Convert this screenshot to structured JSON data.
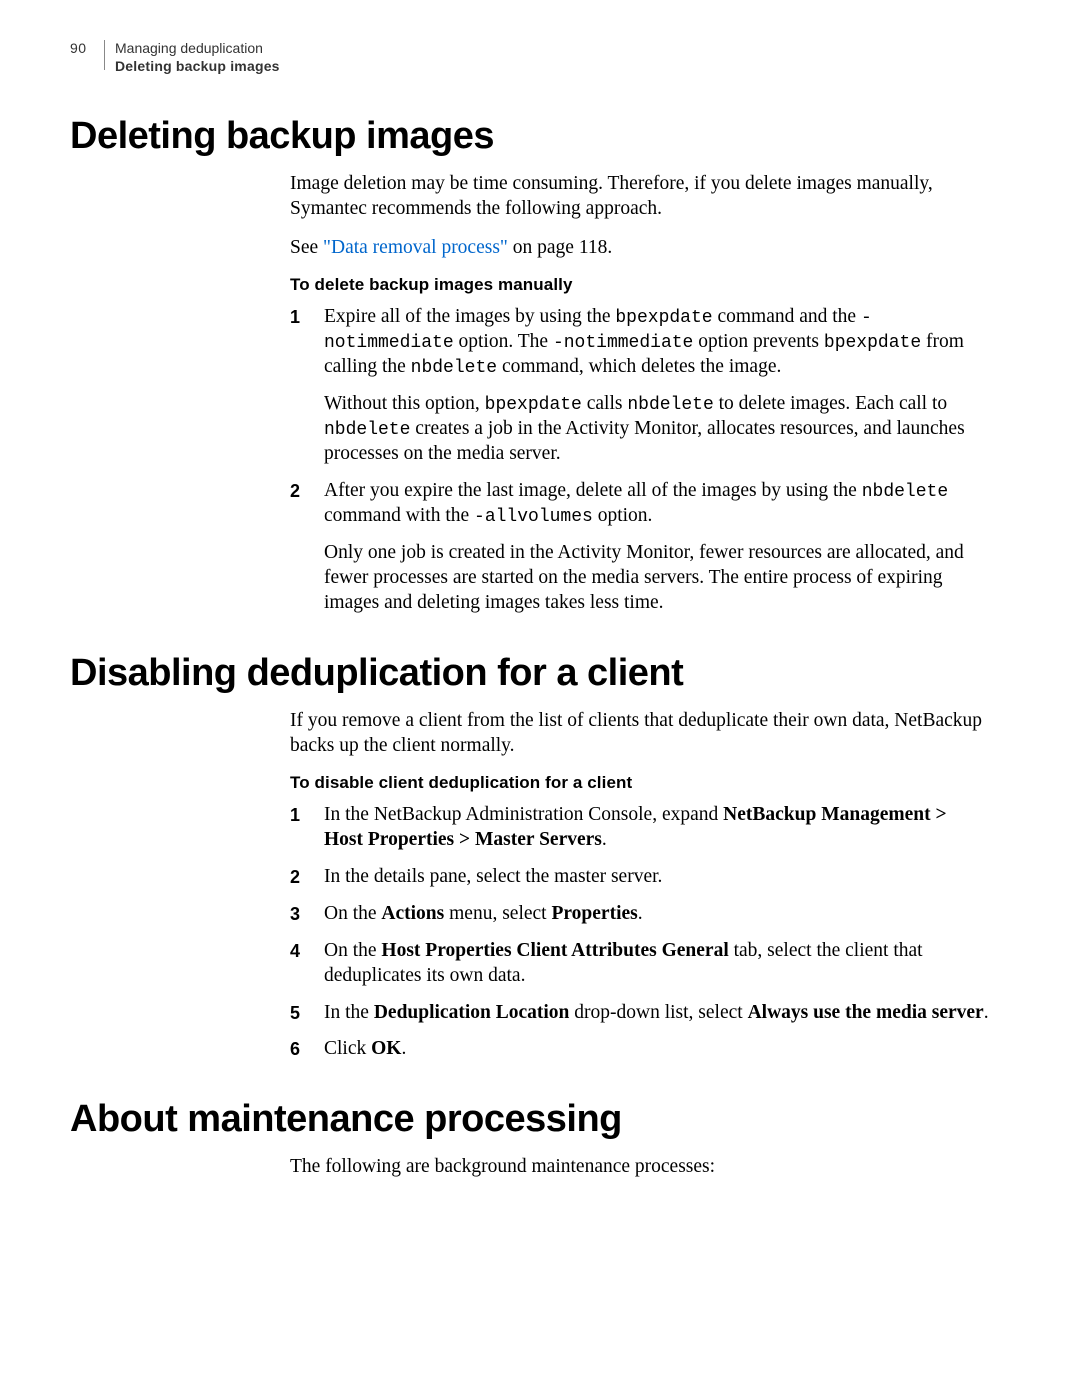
{
  "header": {
    "page_number": "90",
    "line1": "Managing deduplication",
    "line2": "Deleting backup images"
  },
  "s1": {
    "title": "Deleting backup images",
    "p1": "Image deletion may be time consuming. Therefore, if you delete images manually, Symantec recommends the following approach.",
    "xref_pre": "See ",
    "xref_link": "\"Data removal process\"",
    "xref_post": " on page 118.",
    "proc_title": "To delete backup images manually",
    "step1": {
      "num": "1",
      "p1a": "Expire all of the images by using the ",
      "c1": "bpexpdate",
      "p1b": " command and the ",
      "c2": "-notimmediate",
      "p1c": " option. The ",
      "c3": "-notimmediate",
      "p1d": " option prevents ",
      "c4": "bpexpdate",
      "p1e": " from calling the ",
      "c5": "nbdelete",
      "p1f": " command, which deletes the image.",
      "p2a": "Without this option, ",
      "c6": "bpexpdate",
      "p2b": " calls ",
      "c7": "nbdelete",
      "p2c": " to delete images. Each call to ",
      "c8": "nbdelete",
      "p2d": " creates a job in the Activity Monitor, allocates resources, and launches processes on the media server."
    },
    "step2": {
      "num": "2",
      "p1a": "After you expire the last image, delete all of the images by using the ",
      "c1": "nbdelete",
      "p1b": " command with the ",
      "c2": "-allvolumes",
      "p1c": " option.",
      "p2": "Only one job is created in the Activity Monitor, fewer resources are allocated, and fewer processes are started on the media servers. The entire process of expiring images and deleting images takes less time."
    }
  },
  "s2": {
    "title": "Disabling deduplication for a client",
    "p1": "If you remove a client from the list of clients that deduplicate their own data, NetBackup backs up the client normally.",
    "proc_title": "To disable client deduplication for a client",
    "steps": {
      "n1": "1",
      "t1a": "In the NetBackup Administration Console, expand ",
      "t1b": "NetBackup Management > Host Properties > Master Servers",
      "t1c": ".",
      "n2": "2",
      "t2": "In the details pane, select the master server.",
      "n3": "3",
      "t3a": "On the ",
      "t3b": "Actions",
      "t3c": " menu, select ",
      "t3d": "Properties",
      "t3e": ".",
      "n4": "4",
      "t4a": "On the ",
      "t4b": "Host Properties Client Attributes General",
      "t4c": " tab, select the client that deduplicates its own data.",
      "n5": "5",
      "t5a": "In the ",
      "t5b": "Deduplication Location",
      "t5c": " drop-down list, select ",
      "t5d": "Always use the media server",
      "t5e": ".",
      "n6": "6",
      "t6a": "Click ",
      "t6b": "OK",
      "t6c": "."
    }
  },
  "s3": {
    "title": "About maintenance processing",
    "p1": "The following are background maintenance processes:"
  }
}
